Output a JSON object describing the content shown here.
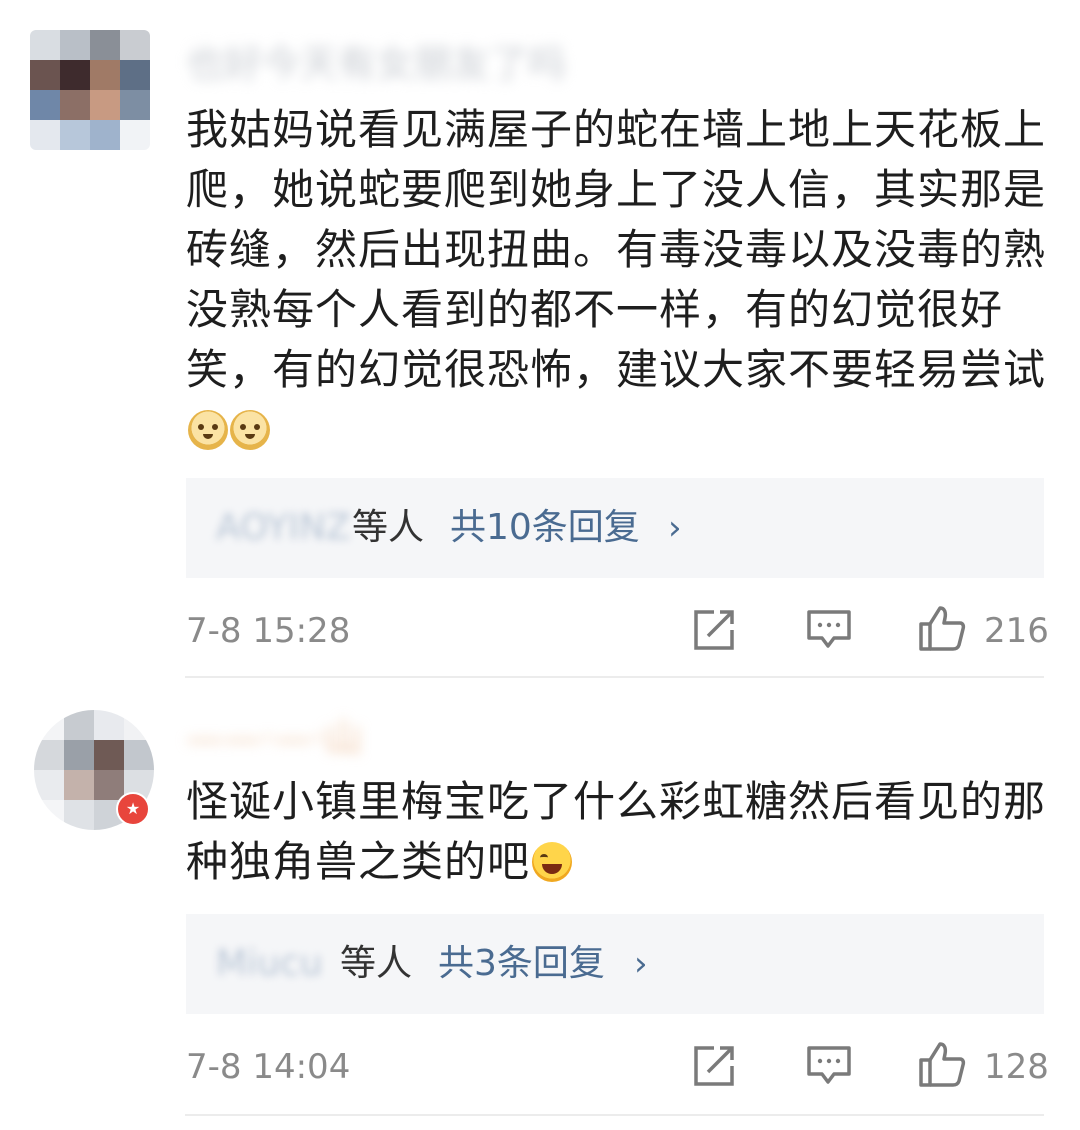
{
  "comments": [
    {
      "username": "也好今天有女朋友了吗",
      "text": "我姑妈说看见满屋子的蛇在墙上地上天花板上爬，她说蛇要爬到她身上了没人信，其实那是砖缝，然后出现扭曲。有毒没毒以及没毒的熟没熟每个人看到的都不一样，有的幻觉很好笑，有的幻觉很恐怖，建议大家不要轻易尝试",
      "emojis": [
        "doge-icon",
        "doge-icon"
      ],
      "reply_names": "AOYINZ",
      "reply_etc": "等人",
      "reply_count": "共10条回复",
      "reply_chevron": "›",
      "time": "7-8 15:28",
      "likes": "216"
    },
    {
      "username": "——·—·山",
      "text": "怪诞小镇里梅宝吃了什么彩虹糖然后看见的那种独角兽之类的吧",
      "emojis": [
        "laughing-tears-icon"
      ],
      "reply_names": "Miucu",
      "reply_etc": "等人",
      "reply_count": "共3条回复",
      "reply_chevron": "›",
      "time": "7-8 14:04",
      "likes": "128"
    }
  ],
  "colors": {
    "link": "#4a6b91",
    "muted": "#8a8a8a",
    "reply_bg": "#f5f6f8",
    "badge": "#e8453c"
  }
}
